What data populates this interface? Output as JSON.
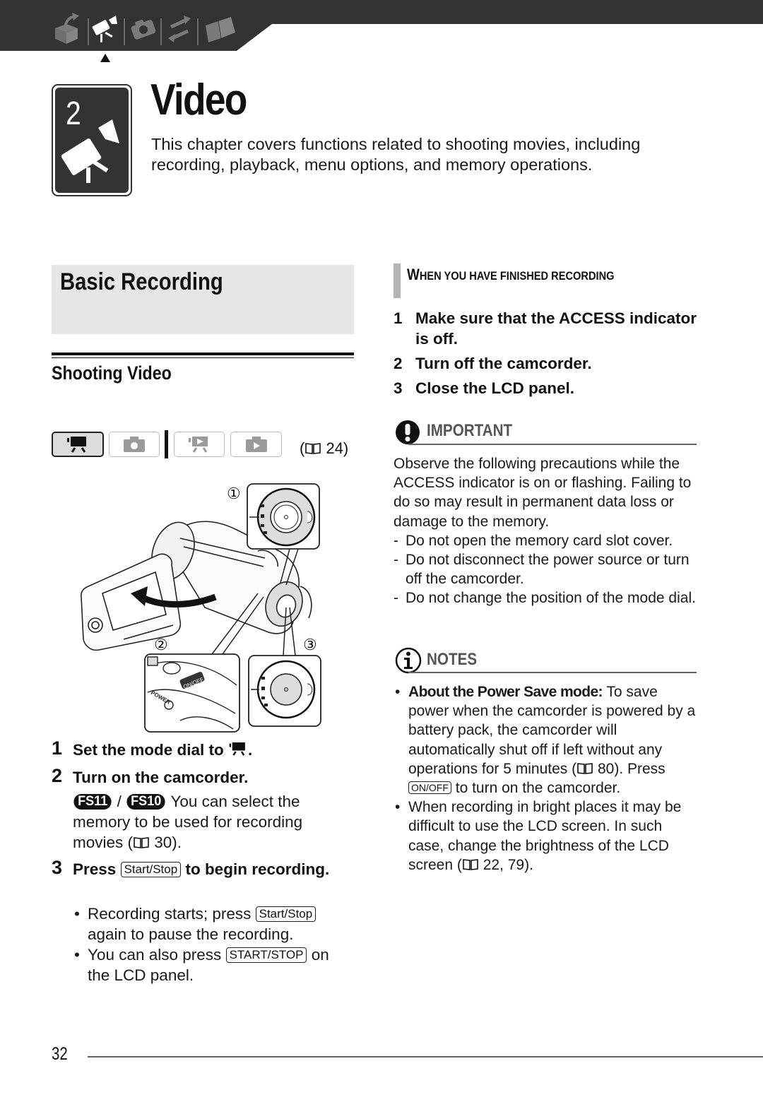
{
  "nav": {
    "items": [
      {
        "icon": "box-icon",
        "label": "Introduction",
        "active": false
      },
      {
        "icon": "video-camera-icon",
        "label": "Video",
        "active": true
      },
      {
        "icon": "photo-camera-icon",
        "label": "Photos",
        "active": false
      },
      {
        "icon": "transfer-icon",
        "label": "External Connections",
        "active": false
      },
      {
        "icon": "book-icon",
        "label": "Additional Information",
        "active": false
      }
    ],
    "band_color": "#333333"
  },
  "chapter": {
    "number": "2",
    "title": "Video",
    "description": "This chapter covers functions related to shooting movies, including recording, playback, menu options, and memory operations."
  },
  "section": {
    "title": "Basic Recording",
    "subsection": "Shooting Video",
    "modes": [
      {
        "icon": "movie-record-mode-icon",
        "active": true
      },
      {
        "icon": "photo-record-mode-icon",
        "active": false
      },
      {
        "icon": "movie-playback-mode-icon",
        "active": false
      },
      {
        "icon": "photo-playback-mode-icon",
        "active": false
      }
    ],
    "mode_ref": {
      "open": "(",
      "page": "24)"
    },
    "figure_callouts": [
      "①",
      "②",
      "③"
    ],
    "figure_labels": {
      "on_off": "ON/OFF",
      "power": "POWER"
    },
    "steps": [
      {
        "num": "1",
        "text": "Set the mode dial to",
        "suffix": "."
      },
      {
        "num": "2",
        "text": "Turn on the camcorder.",
        "models": [
          "FS11",
          "FS10"
        ],
        "model_sep": "/",
        "detail": "You can select the memory to be used for recording movies (",
        "detail_page": "30)."
      },
      {
        "num": "3",
        "text_pre": "Press",
        "key": "Start/Stop",
        "text_post": "to begin recording.",
        "bullets": [
          {
            "pre": "Recording starts; press",
            "key": "Start/Stop",
            "post": "again to pause the recording."
          },
          {
            "pre": "You can also press",
            "key": "START/STOP",
            "post": "on the LCD panel."
          }
        ]
      }
    ]
  },
  "finished": {
    "heading_first": "W",
    "heading_rest": "HEN YOU HAVE FINISHED RECORDING",
    "steps": [
      {
        "num": "1",
        "text": "Make sure that the ACCESS indicator is off."
      },
      {
        "num": "2",
        "text": "Turn off the camcorder."
      },
      {
        "num": "3",
        "text": "Close the LCD panel."
      }
    ]
  },
  "important": {
    "heading": "IMPORTANT",
    "intro": "Observe the following precautions while the ACCESS indicator is on or flashing. Failing to do so may result in permanent data loss or damage to the memory.",
    "items": [
      "Do not open the memory card slot cover.",
      "Do not disconnect the power source or turn off the camcorder.",
      "Do not change the position of the mode dial."
    ]
  },
  "notes": {
    "heading": "NOTES",
    "items": [
      {
        "bold": "About the Power Save mode:",
        "text": " To save power when the camcorder is powered by a battery pack, the camcorder will automatically shut off if left without any operations for 5 minutes (",
        "page": "80). Press",
        "key": "ON/OFF",
        "tail": "to turn on the camcorder."
      },
      {
        "text": "When recording in bright places it may be difficult to use the LCD screen. In such case, change the brightness of the LCD screen (",
        "page": "22, 79)."
      }
    ]
  },
  "footer": {
    "page_number": "32"
  }
}
